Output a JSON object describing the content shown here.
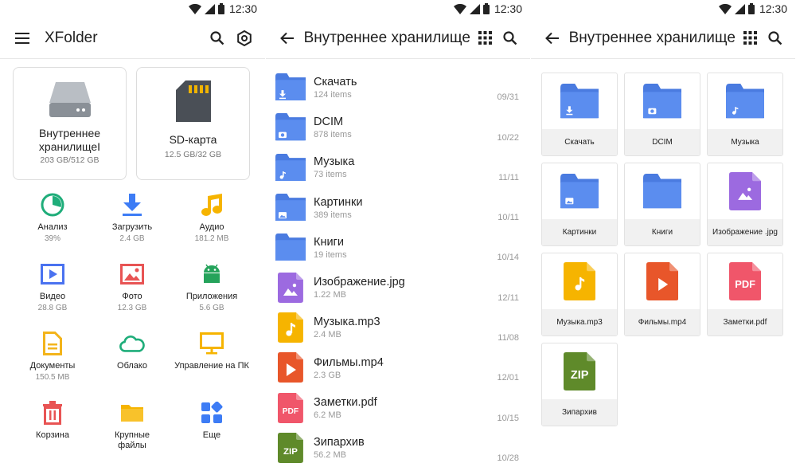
{
  "status": {
    "time": "12:30"
  },
  "screen1": {
    "title": "XFolder",
    "storage": [
      {
        "name": "Внутреннее хранилищеI",
        "size": "203 GB/512 GB",
        "icon": "hdd-icon"
      },
      {
        "name": "SD-карта",
        "size": "12.5 GB/32 GB",
        "icon": "sd-card-icon"
      }
    ],
    "categories": [
      {
        "label": "Анализ",
        "sub": "39%",
        "icon": "analysis-icon",
        "color": "#1fad7a"
      },
      {
        "label": "Загрузить",
        "sub": "2.4 GB",
        "icon": "download-icon",
        "color": "#3d7cf5"
      },
      {
        "label": "Аудио",
        "sub": "181.2 MB",
        "icon": "music-icon",
        "color": "#f6b400"
      },
      {
        "label": "Видео",
        "sub": "28.8 GB",
        "icon": "video-icon",
        "color": "#4a72f0"
      },
      {
        "label": "Фото",
        "sub": "12.3 GB",
        "icon": "photo-icon",
        "color": "#e85454"
      },
      {
        "label": "Приложения",
        "sub": "5.6 GB",
        "icon": "android-icon",
        "color": "#25a35b"
      },
      {
        "label": "Документы",
        "sub": "150.5 MB",
        "icon": "document-icon",
        "color": "#f3b41b"
      },
      {
        "label": "Облако",
        "sub": "",
        "icon": "cloud-icon",
        "color": "#1fad7a"
      },
      {
        "label": "Управление на ПК",
        "sub": "",
        "icon": "monitor-icon",
        "color": "#f6b400"
      },
      {
        "label": "Корзина",
        "sub": "",
        "icon": "trash-icon",
        "color": "#e85454"
      },
      {
        "label": "Крупные файлы",
        "sub": "",
        "icon": "large-files-icon",
        "color": "#f6b400"
      },
      {
        "label": "Еще",
        "sub": "",
        "icon": "more-icon",
        "color": "#3d7cf5"
      }
    ]
  },
  "screen2": {
    "title": "Внутреннее хранилище",
    "rows": [
      {
        "name": "Скачать",
        "sub": "124 items",
        "date": "09/31",
        "icon": "folder-download-icon"
      },
      {
        "name": "DCIM",
        "sub": "878 items",
        "date": "10/22",
        "icon": "folder-camera-icon"
      },
      {
        "name": "Музыка",
        "sub": "73 items",
        "date": "11/11",
        "icon": "folder-music-icon"
      },
      {
        "name": "Картинки",
        "sub": "389 items",
        "date": "10/11",
        "icon": "folder-image-icon"
      },
      {
        "name": "Книги",
        "sub": "19 items",
        "date": "10/14",
        "icon": "folder-icon"
      },
      {
        "name": "Изображение.jpg",
        "sub": "1.22 MB",
        "date": "12/11",
        "icon": "image-file-icon"
      },
      {
        "name": "Музыка.mp3",
        "sub": "2.4 MB",
        "date": "11/08",
        "icon": "music-file-icon"
      },
      {
        "name": "Фильмы.mp4",
        "sub": "2.3 GB",
        "date": "12/01",
        "icon": "video-file-icon"
      },
      {
        "name": "Заметки.pdf",
        "sub": "6.2 MB",
        "date": "10/15",
        "icon": "pdf-file-icon"
      },
      {
        "name": "Зипархив",
        "sub": "56.2 MB",
        "date": "10/28",
        "icon": "zip-file-icon"
      }
    ]
  },
  "screen3": {
    "title": "Внутреннее хранилище",
    "tiles": [
      {
        "name": "Скачать",
        "icon": "folder-download-icon"
      },
      {
        "name": "DCIM",
        "icon": "folder-camera-icon"
      },
      {
        "name": "Музыка",
        "icon": "folder-music-icon"
      },
      {
        "name": "Картинки",
        "icon": "folder-image-icon"
      },
      {
        "name": "Книги",
        "icon": "folder-icon"
      },
      {
        "name": "Изображение .jpg",
        "icon": "image-file-icon"
      },
      {
        "name": "Музыка.mp3",
        "icon": "music-file-icon"
      },
      {
        "name": "Фильмы.mp4",
        "icon": "video-file-icon"
      },
      {
        "name": "Заметки.pdf",
        "icon": "pdf-file-icon"
      },
      {
        "name": "Зипархив",
        "icon": "zip-file-icon"
      }
    ]
  },
  "labels": {
    "pdf": "PDF",
    "zip": "ZIP"
  },
  "colors": {
    "folder": "#5b8def",
    "folderDark": "#4a7be0",
    "image": "#9c6ae0",
    "music": "#f6b400",
    "video": "#e8562a",
    "pdf": "#f0566a",
    "zip": "#5f8a2a"
  }
}
